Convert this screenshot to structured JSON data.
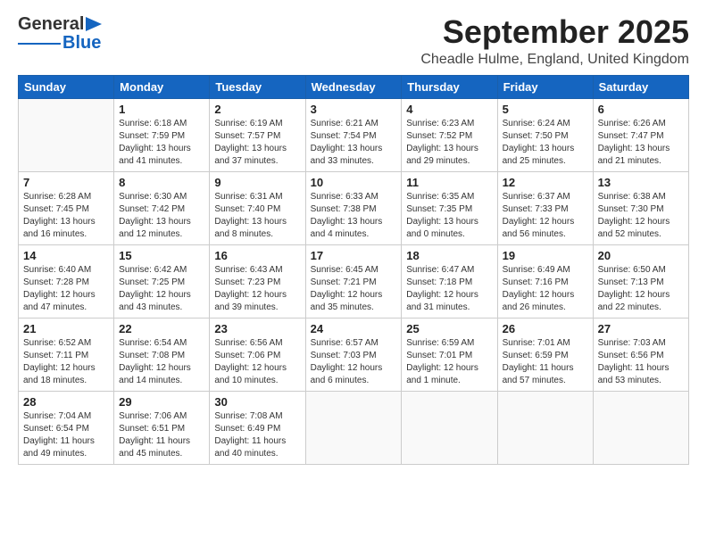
{
  "header": {
    "logo_general": "General",
    "logo_blue": "Blue",
    "month_title": "September 2025",
    "location": "Cheadle Hulme, England, United Kingdom"
  },
  "weekdays": [
    "Sunday",
    "Monday",
    "Tuesday",
    "Wednesday",
    "Thursday",
    "Friday",
    "Saturday"
  ],
  "weeks": [
    [
      {
        "day": "",
        "text": ""
      },
      {
        "day": "1",
        "text": "Sunrise: 6:18 AM\nSunset: 7:59 PM\nDaylight: 13 hours\nand 41 minutes."
      },
      {
        "day": "2",
        "text": "Sunrise: 6:19 AM\nSunset: 7:57 PM\nDaylight: 13 hours\nand 37 minutes."
      },
      {
        "day": "3",
        "text": "Sunrise: 6:21 AM\nSunset: 7:54 PM\nDaylight: 13 hours\nand 33 minutes."
      },
      {
        "day": "4",
        "text": "Sunrise: 6:23 AM\nSunset: 7:52 PM\nDaylight: 13 hours\nand 29 minutes."
      },
      {
        "day": "5",
        "text": "Sunrise: 6:24 AM\nSunset: 7:50 PM\nDaylight: 13 hours\nand 25 minutes."
      },
      {
        "day": "6",
        "text": "Sunrise: 6:26 AM\nSunset: 7:47 PM\nDaylight: 13 hours\nand 21 minutes."
      }
    ],
    [
      {
        "day": "7",
        "text": "Sunrise: 6:28 AM\nSunset: 7:45 PM\nDaylight: 13 hours\nand 16 minutes."
      },
      {
        "day": "8",
        "text": "Sunrise: 6:30 AM\nSunset: 7:42 PM\nDaylight: 13 hours\nand 12 minutes."
      },
      {
        "day": "9",
        "text": "Sunrise: 6:31 AM\nSunset: 7:40 PM\nDaylight: 13 hours\nand 8 minutes."
      },
      {
        "day": "10",
        "text": "Sunrise: 6:33 AM\nSunset: 7:38 PM\nDaylight: 13 hours\nand 4 minutes."
      },
      {
        "day": "11",
        "text": "Sunrise: 6:35 AM\nSunset: 7:35 PM\nDaylight: 13 hours\nand 0 minutes."
      },
      {
        "day": "12",
        "text": "Sunrise: 6:37 AM\nSunset: 7:33 PM\nDaylight: 12 hours\nand 56 minutes."
      },
      {
        "day": "13",
        "text": "Sunrise: 6:38 AM\nSunset: 7:30 PM\nDaylight: 12 hours\nand 52 minutes."
      }
    ],
    [
      {
        "day": "14",
        "text": "Sunrise: 6:40 AM\nSunset: 7:28 PM\nDaylight: 12 hours\nand 47 minutes."
      },
      {
        "day": "15",
        "text": "Sunrise: 6:42 AM\nSunset: 7:25 PM\nDaylight: 12 hours\nand 43 minutes."
      },
      {
        "day": "16",
        "text": "Sunrise: 6:43 AM\nSunset: 7:23 PM\nDaylight: 12 hours\nand 39 minutes."
      },
      {
        "day": "17",
        "text": "Sunrise: 6:45 AM\nSunset: 7:21 PM\nDaylight: 12 hours\nand 35 minutes."
      },
      {
        "day": "18",
        "text": "Sunrise: 6:47 AM\nSunset: 7:18 PM\nDaylight: 12 hours\nand 31 minutes."
      },
      {
        "day": "19",
        "text": "Sunrise: 6:49 AM\nSunset: 7:16 PM\nDaylight: 12 hours\nand 26 minutes."
      },
      {
        "day": "20",
        "text": "Sunrise: 6:50 AM\nSunset: 7:13 PM\nDaylight: 12 hours\nand 22 minutes."
      }
    ],
    [
      {
        "day": "21",
        "text": "Sunrise: 6:52 AM\nSunset: 7:11 PM\nDaylight: 12 hours\nand 18 minutes."
      },
      {
        "day": "22",
        "text": "Sunrise: 6:54 AM\nSunset: 7:08 PM\nDaylight: 12 hours\nand 14 minutes."
      },
      {
        "day": "23",
        "text": "Sunrise: 6:56 AM\nSunset: 7:06 PM\nDaylight: 12 hours\nand 10 minutes."
      },
      {
        "day": "24",
        "text": "Sunrise: 6:57 AM\nSunset: 7:03 PM\nDaylight: 12 hours\nand 6 minutes."
      },
      {
        "day": "25",
        "text": "Sunrise: 6:59 AM\nSunset: 7:01 PM\nDaylight: 12 hours\nand 1 minute."
      },
      {
        "day": "26",
        "text": "Sunrise: 7:01 AM\nSunset: 6:59 PM\nDaylight: 11 hours\nand 57 minutes."
      },
      {
        "day": "27",
        "text": "Sunrise: 7:03 AM\nSunset: 6:56 PM\nDaylight: 11 hours\nand 53 minutes."
      }
    ],
    [
      {
        "day": "28",
        "text": "Sunrise: 7:04 AM\nSunset: 6:54 PM\nDaylight: 11 hours\nand 49 minutes."
      },
      {
        "day": "29",
        "text": "Sunrise: 7:06 AM\nSunset: 6:51 PM\nDaylight: 11 hours\nand 45 minutes."
      },
      {
        "day": "30",
        "text": "Sunrise: 7:08 AM\nSunset: 6:49 PM\nDaylight: 11 hours\nand 40 minutes."
      },
      {
        "day": "",
        "text": ""
      },
      {
        "day": "",
        "text": ""
      },
      {
        "day": "",
        "text": ""
      },
      {
        "day": "",
        "text": ""
      }
    ]
  ]
}
